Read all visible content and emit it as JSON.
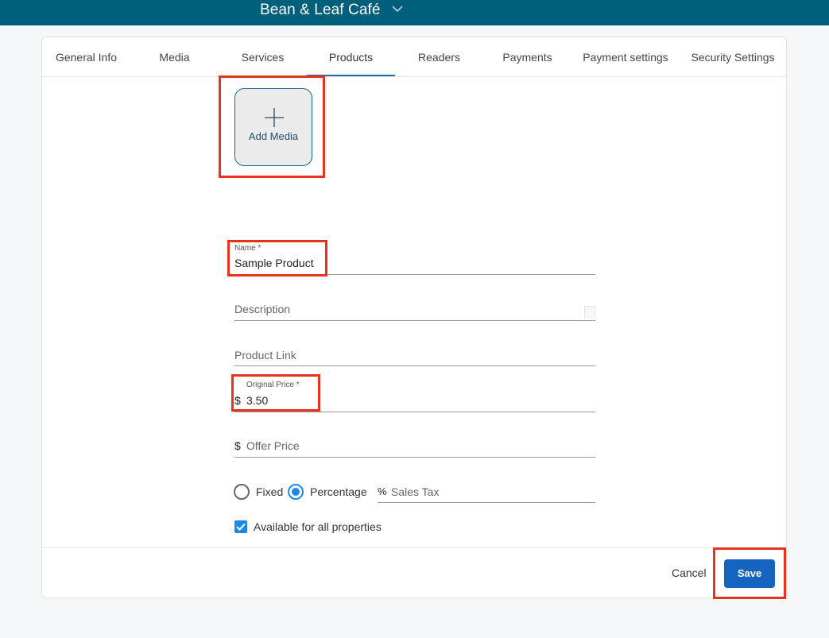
{
  "header": {
    "title": "Bean & Leaf Café",
    "chevron_icon": "chevron-down-icon"
  },
  "tabs": [
    {
      "label": "General Info"
    },
    {
      "label": "Media"
    },
    {
      "label": "Services"
    },
    {
      "label": "Products",
      "active": true
    },
    {
      "label": "Readers"
    },
    {
      "label": "Payments"
    },
    {
      "label": "Payment settings"
    },
    {
      "label": "Security Settings"
    }
  ],
  "media": {
    "add_label": "Add Media",
    "icon": "plus-icon"
  },
  "form": {
    "name_label": "Name *",
    "name_value": "Sample Product",
    "description_placeholder": "Description",
    "product_link_placeholder": "Product Link",
    "original_price_label": "Original Price *",
    "currency_symbol": "$",
    "original_price_value": "3.50",
    "offer_price_placeholder": "Offer Price",
    "tax_type_options": [
      {
        "label": "Fixed",
        "selected": false
      },
      {
        "label": "Percentage",
        "selected": true
      }
    ],
    "percent_symbol": "%",
    "sales_tax_placeholder": "Sales Tax",
    "available_all_label": "Available for all properties",
    "available_all_checked": true
  },
  "actions": {
    "cancel_label": "Cancel",
    "save_label": "Save"
  },
  "colors": {
    "header_bg": "#005f7a",
    "accent": "#1e88e5",
    "save_bg": "#1565c0",
    "highlight": "#e8321e"
  }
}
